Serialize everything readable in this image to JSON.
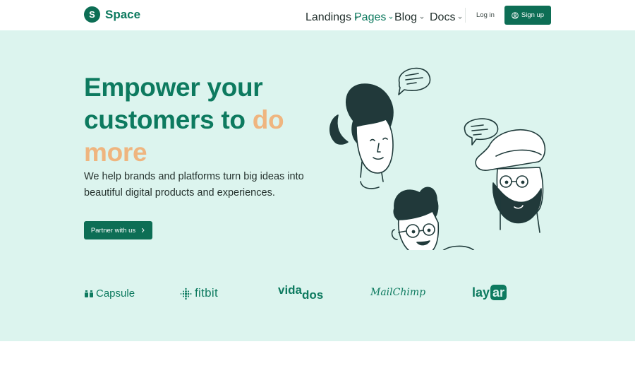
{
  "nav": {
    "logo_letter": "S",
    "logo_text": "Space",
    "items": [
      {
        "label": "Landings",
        "active": false
      },
      {
        "label": "Pages",
        "active": true
      },
      {
        "label": "Blog",
        "active": false
      },
      {
        "label": "Docs",
        "active": false
      }
    ],
    "login_label": "Log in",
    "signup_label": "Sign up"
  },
  "hero": {
    "headline_part1": "Empower your customers to ",
    "headline_accent": "do more",
    "subtext": "We help brands and platforms turn big ideas into beautiful digital products and experiences.",
    "cta_label": "Partner with us"
  },
  "brands": {
    "capsule": "Capsule",
    "fitbit": "fitbit",
    "vidados_a": "vida",
    "vidados_b": "dos",
    "mailchimp": "MailChimp",
    "layar_a": "lay",
    "layar_b": "ar"
  },
  "colors": {
    "brand_green": "#0d6e55",
    "accent_orange": "#efb57f",
    "hero_bg": "#dcf4ee"
  }
}
